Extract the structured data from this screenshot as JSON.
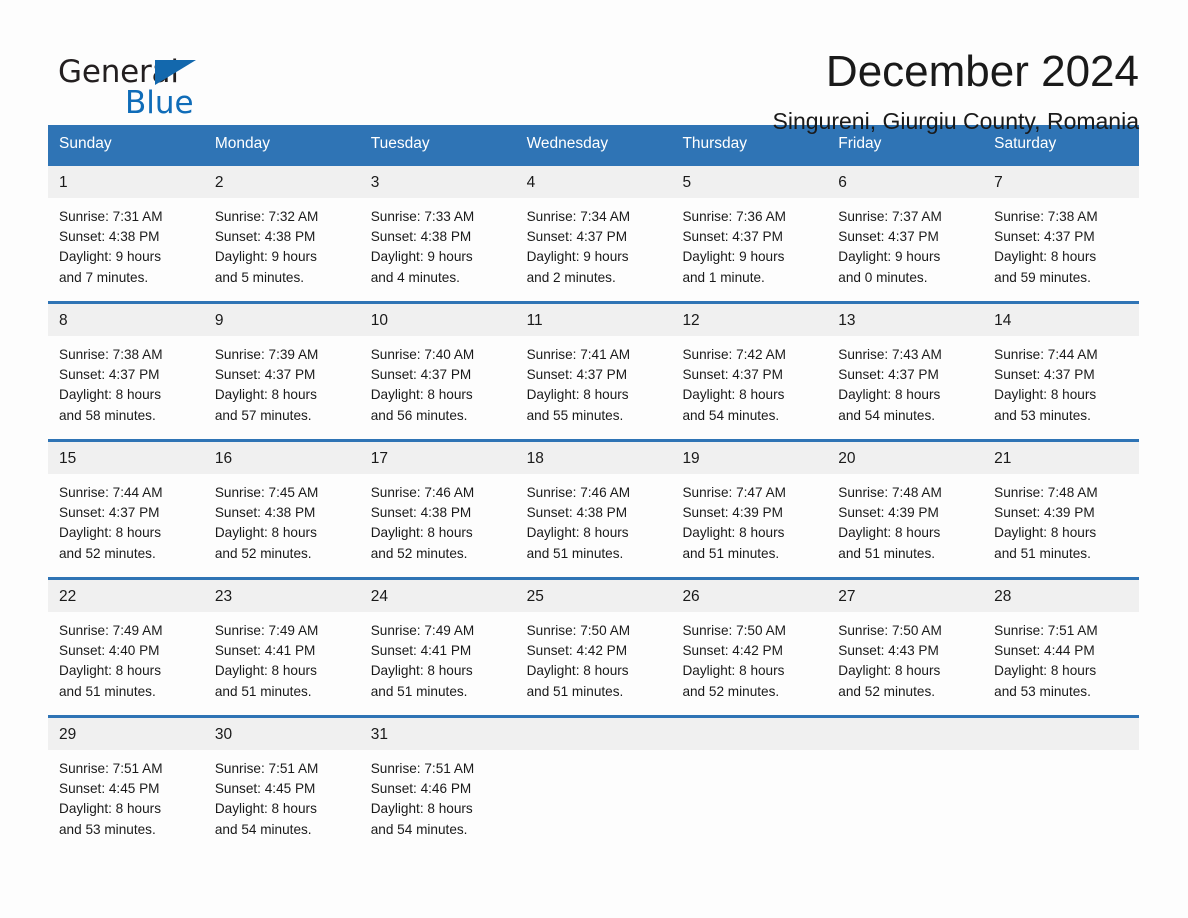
{
  "logo": {
    "word1": "General",
    "word2": "Blue",
    "triangle_color": "#1368ad",
    "word2_color": "#0f6cb8"
  },
  "header": {
    "title": "December 2024",
    "location": "Singureni, Giurgiu County, Romania"
  },
  "theme": {
    "header_bg": "#2f74b5",
    "header_text": "#ffffff",
    "daynum_bg": "#f0f0f0",
    "row_border": "#2f74b5",
    "page_bg": "#fdfdfd",
    "text": "#1a1a1a"
  },
  "calendar": {
    "weekday_headers": [
      "Sunday",
      "Monday",
      "Tuesday",
      "Wednesday",
      "Thursday",
      "Friday",
      "Saturday"
    ],
    "weeks": [
      [
        {
          "day": "1",
          "sunrise": "Sunrise: 7:31 AM",
          "sunset": "Sunset: 4:38 PM",
          "daylight1": "Daylight: 9 hours",
          "daylight2": "and 7 minutes."
        },
        {
          "day": "2",
          "sunrise": "Sunrise: 7:32 AM",
          "sunset": "Sunset: 4:38 PM",
          "daylight1": "Daylight: 9 hours",
          "daylight2": "and 5 minutes."
        },
        {
          "day": "3",
          "sunrise": "Sunrise: 7:33 AM",
          "sunset": "Sunset: 4:38 PM",
          "daylight1": "Daylight: 9 hours",
          "daylight2": "and 4 minutes."
        },
        {
          "day": "4",
          "sunrise": "Sunrise: 7:34 AM",
          "sunset": "Sunset: 4:37 PM",
          "daylight1": "Daylight: 9 hours",
          "daylight2": "and 2 minutes."
        },
        {
          "day": "5",
          "sunrise": "Sunrise: 7:36 AM",
          "sunset": "Sunset: 4:37 PM",
          "daylight1": "Daylight: 9 hours",
          "daylight2": "and 1 minute."
        },
        {
          "day": "6",
          "sunrise": "Sunrise: 7:37 AM",
          "sunset": "Sunset: 4:37 PM",
          "daylight1": "Daylight: 9 hours",
          "daylight2": "and 0 minutes."
        },
        {
          "day": "7",
          "sunrise": "Sunrise: 7:38 AM",
          "sunset": "Sunset: 4:37 PM",
          "daylight1": "Daylight: 8 hours",
          "daylight2": "and 59 minutes."
        }
      ],
      [
        {
          "day": "8",
          "sunrise": "Sunrise: 7:38 AM",
          "sunset": "Sunset: 4:37 PM",
          "daylight1": "Daylight: 8 hours",
          "daylight2": "and 58 minutes."
        },
        {
          "day": "9",
          "sunrise": "Sunrise: 7:39 AM",
          "sunset": "Sunset: 4:37 PM",
          "daylight1": "Daylight: 8 hours",
          "daylight2": "and 57 minutes."
        },
        {
          "day": "10",
          "sunrise": "Sunrise: 7:40 AM",
          "sunset": "Sunset: 4:37 PM",
          "daylight1": "Daylight: 8 hours",
          "daylight2": "and 56 minutes."
        },
        {
          "day": "11",
          "sunrise": "Sunrise: 7:41 AM",
          "sunset": "Sunset: 4:37 PM",
          "daylight1": "Daylight: 8 hours",
          "daylight2": "and 55 minutes."
        },
        {
          "day": "12",
          "sunrise": "Sunrise: 7:42 AM",
          "sunset": "Sunset: 4:37 PM",
          "daylight1": "Daylight: 8 hours",
          "daylight2": "and 54 minutes."
        },
        {
          "day": "13",
          "sunrise": "Sunrise: 7:43 AM",
          "sunset": "Sunset: 4:37 PM",
          "daylight1": "Daylight: 8 hours",
          "daylight2": "and 54 minutes."
        },
        {
          "day": "14",
          "sunrise": "Sunrise: 7:44 AM",
          "sunset": "Sunset: 4:37 PM",
          "daylight1": "Daylight: 8 hours",
          "daylight2": "and 53 minutes."
        }
      ],
      [
        {
          "day": "15",
          "sunrise": "Sunrise: 7:44 AM",
          "sunset": "Sunset: 4:37 PM",
          "daylight1": "Daylight: 8 hours",
          "daylight2": "and 52 minutes."
        },
        {
          "day": "16",
          "sunrise": "Sunrise: 7:45 AM",
          "sunset": "Sunset: 4:38 PM",
          "daylight1": "Daylight: 8 hours",
          "daylight2": "and 52 minutes."
        },
        {
          "day": "17",
          "sunrise": "Sunrise: 7:46 AM",
          "sunset": "Sunset: 4:38 PM",
          "daylight1": "Daylight: 8 hours",
          "daylight2": "and 52 minutes."
        },
        {
          "day": "18",
          "sunrise": "Sunrise: 7:46 AM",
          "sunset": "Sunset: 4:38 PM",
          "daylight1": "Daylight: 8 hours",
          "daylight2": "and 51 minutes."
        },
        {
          "day": "19",
          "sunrise": "Sunrise: 7:47 AM",
          "sunset": "Sunset: 4:39 PM",
          "daylight1": "Daylight: 8 hours",
          "daylight2": "and 51 minutes."
        },
        {
          "day": "20",
          "sunrise": "Sunrise: 7:48 AM",
          "sunset": "Sunset: 4:39 PM",
          "daylight1": "Daylight: 8 hours",
          "daylight2": "and 51 minutes."
        },
        {
          "day": "21",
          "sunrise": "Sunrise: 7:48 AM",
          "sunset": "Sunset: 4:39 PM",
          "daylight1": "Daylight: 8 hours",
          "daylight2": "and 51 minutes."
        }
      ],
      [
        {
          "day": "22",
          "sunrise": "Sunrise: 7:49 AM",
          "sunset": "Sunset: 4:40 PM",
          "daylight1": "Daylight: 8 hours",
          "daylight2": "and 51 minutes."
        },
        {
          "day": "23",
          "sunrise": "Sunrise: 7:49 AM",
          "sunset": "Sunset: 4:41 PM",
          "daylight1": "Daylight: 8 hours",
          "daylight2": "and 51 minutes."
        },
        {
          "day": "24",
          "sunrise": "Sunrise: 7:49 AM",
          "sunset": "Sunset: 4:41 PM",
          "daylight1": "Daylight: 8 hours",
          "daylight2": "and 51 minutes."
        },
        {
          "day": "25",
          "sunrise": "Sunrise: 7:50 AM",
          "sunset": "Sunset: 4:42 PM",
          "daylight1": "Daylight: 8 hours",
          "daylight2": "and 51 minutes."
        },
        {
          "day": "26",
          "sunrise": "Sunrise: 7:50 AM",
          "sunset": "Sunset: 4:42 PM",
          "daylight1": "Daylight: 8 hours",
          "daylight2": "and 52 minutes."
        },
        {
          "day": "27",
          "sunrise": "Sunrise: 7:50 AM",
          "sunset": "Sunset: 4:43 PM",
          "daylight1": "Daylight: 8 hours",
          "daylight2": "and 52 minutes."
        },
        {
          "day": "28",
          "sunrise": "Sunrise: 7:51 AM",
          "sunset": "Sunset: 4:44 PM",
          "daylight1": "Daylight: 8 hours",
          "daylight2": "and 53 minutes."
        }
      ],
      [
        {
          "day": "29",
          "sunrise": "Sunrise: 7:51 AM",
          "sunset": "Sunset: 4:45 PM",
          "daylight1": "Daylight: 8 hours",
          "daylight2": "and 53 minutes."
        },
        {
          "day": "30",
          "sunrise": "Sunrise: 7:51 AM",
          "sunset": "Sunset: 4:45 PM",
          "daylight1": "Daylight: 8 hours",
          "daylight2": "and 54 minutes."
        },
        {
          "day": "31",
          "sunrise": "Sunrise: 7:51 AM",
          "sunset": "Sunset: 4:46 PM",
          "daylight1": "Daylight: 8 hours",
          "daylight2": "and 54 minutes."
        },
        {
          "day": "",
          "sunrise": "",
          "sunset": "",
          "daylight1": "",
          "daylight2": ""
        },
        {
          "day": "",
          "sunrise": "",
          "sunset": "",
          "daylight1": "",
          "daylight2": ""
        },
        {
          "day": "",
          "sunrise": "",
          "sunset": "",
          "daylight1": "",
          "daylight2": ""
        },
        {
          "day": "",
          "sunrise": "",
          "sunset": "",
          "daylight1": "",
          "daylight2": ""
        }
      ]
    ]
  }
}
